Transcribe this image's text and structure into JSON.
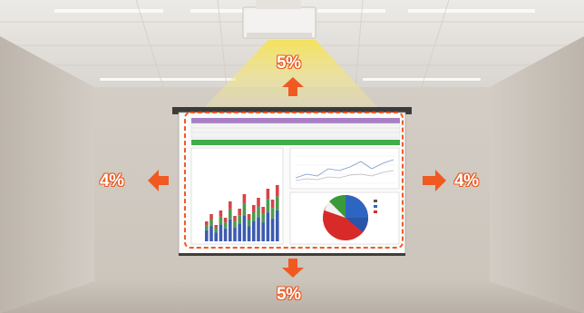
{
  "shift": {
    "up": "5%",
    "down": "5%",
    "left": "4%",
    "right": "4%"
  },
  "colors": {
    "arrow": "#f05a22",
    "dashed_frame": "#f05a22",
    "beam": "#f3e46a",
    "wall": "#d8d2ca",
    "ceiling": "#e6e3df",
    "screen": "#fbfbfb",
    "spreadsheet_header": "#a97fc4",
    "spreadsheet_band": "#3fae49",
    "bar_blue": "#3d5bb0",
    "bar_green": "#4c9a4f",
    "bar_red": "#d8424b",
    "pie_red": "#d92a2a",
    "pie_blue": "#2d66c2",
    "pie_green": "#3a9a3a"
  },
  "icons": [
    "arrow-up-icon",
    "arrow-down-icon",
    "arrow-left-icon",
    "arrow-right-icon",
    "projector-icon"
  ]
}
